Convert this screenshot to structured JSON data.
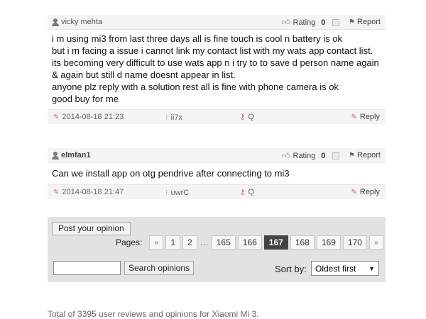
{
  "opinions": [
    {
      "user": "vicky mehta",
      "rating_label": "Rating",
      "rating_value": "0",
      "report_label": "Report",
      "body": [
        "i m using mi3 from last three days all is fine touch is cool n battery is ok",
        "but i m facing a issue i cannot link my contact list with my wats app contact list.",
        "its becoming very difficult to use wats app n i try to to save d person name again & again but still d name doesnt appear in list.",
        "anyone plz reply with a solution rest all is fine with phone camera is ok",
        "good buy for me"
      ],
      "date": "2014-08-18 21:23",
      "location": "ii7x",
      "q_label": "Q",
      "reply_label": "Reply"
    },
    {
      "user": "elmfan1",
      "rating_label": "Rating",
      "rating_value": "0",
      "report_label": "Report",
      "body": [
        "Can we install app on otg pendrive after connecting to mi3"
      ],
      "date": "2014-08-18 21:47",
      "location": "uwrC",
      "q_label": "Q",
      "reply_label": "Reply"
    }
  ],
  "controls": {
    "post_button": "Post your opinion",
    "pages_label": "Pages:",
    "prev": "«",
    "next": "»",
    "ellipsis": "…",
    "pages": [
      "1",
      "2",
      "165",
      "166",
      "167",
      "168",
      "169",
      "170"
    ],
    "current_page": "167",
    "search_placeholder": "",
    "search_button": "Search opinions",
    "sort_label": "Sort by:",
    "sort_selected": "Oldest first"
  },
  "footer": {
    "total_text": "Total of 3395 user reviews and opinions for Xiaomi Mi 3."
  },
  "colors": {
    "active_page": "#444444",
    "accent_icon": "#cc6666"
  }
}
